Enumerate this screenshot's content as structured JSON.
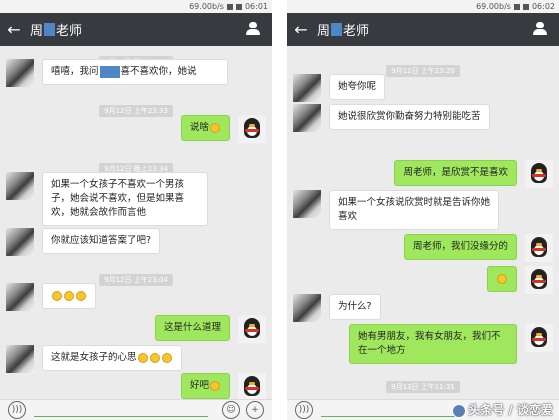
{
  "left_phone": {
    "status": {
      "speed": "69.00b/s",
      "time": "06:01"
    },
    "title": {
      "prefix": "周",
      "suffix": "老师"
    },
    "back_icon": "arrow-left-icon",
    "profile_icon": "person-icon",
    "timestamps": [
      "9月12日 晚上23:33",
      "9月12日 上午23:33",
      "9月12日 晚上23:34",
      "9月12日 上午23:04"
    ],
    "messages": [
      {
        "side": "left",
        "pre": "嘻嘻，我问",
        "post": "喜不喜欢你，她说"
      },
      {
        "side": "right",
        "text": "说啥"
      },
      {
        "side": "left",
        "text": "如果一个女孩子不喜欢一个男孩子，她会说不喜欢，但是如果喜欢，她就会故作而言他"
      },
      {
        "side": "left",
        "text": "你就应该知道答案了吧?"
      },
      {
        "side": "left",
        "text": ""
      },
      {
        "side": "right",
        "text": "这是什么道理"
      },
      {
        "side": "left",
        "text": "这就是女孩子的心思"
      },
      {
        "side": "right",
        "text": "好吧"
      }
    ]
  },
  "right_phone": {
    "status": {
      "speed": "69.00b/s",
      "time": "06:02"
    },
    "title": {
      "prefix": "周",
      "suffix": "老师"
    },
    "timestamps": [
      "9月12日 上午23:20",
      "9月13日 上午11:31"
    ],
    "messages": [
      {
        "side": "left",
        "text": "她夸你呢"
      },
      {
        "side": "left",
        "text": "她说很欣赏你勤奋努力特别能吃苦"
      },
      {
        "side": "right",
        "text": "周老师，是欣赏不是喜欢"
      },
      {
        "side": "left",
        "text": "如果一个女孩说欣赏时就是告诉你她喜欢"
      },
      {
        "side": "right",
        "text": "周老师，我们没缘分的"
      },
      {
        "side": "right",
        "text": ""
      },
      {
        "side": "left",
        "text": "为什么?"
      },
      {
        "side": "right",
        "text": "她有男朋友，我有女朋友，我们不在一个地方"
      }
    ]
  },
  "watermark": "头条号 / 谈恋爱"
}
